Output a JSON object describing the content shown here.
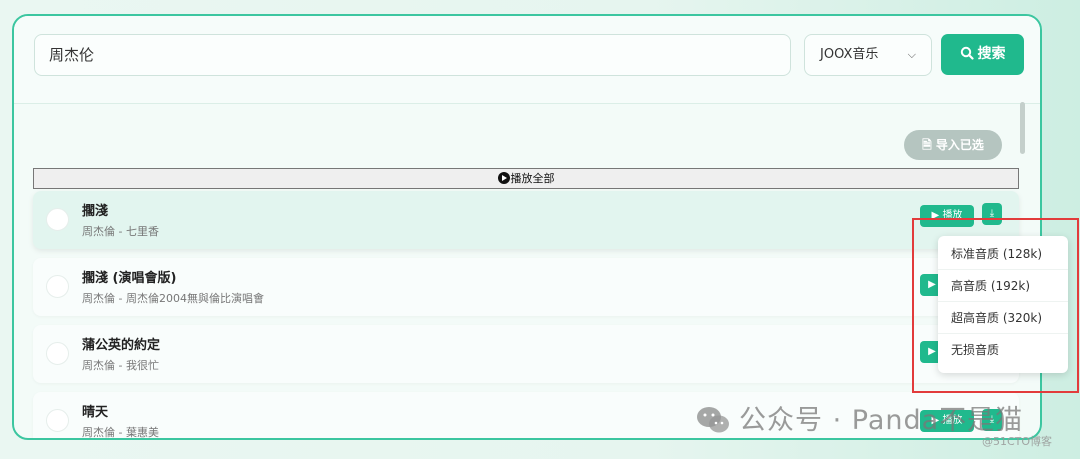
{
  "search": {
    "query": "周杰伦",
    "source": "JOOX音乐",
    "button_label": "搜索"
  },
  "toolbar": {
    "import_label": "导入已选",
    "play_all_label": "播放全部"
  },
  "songs": [
    {
      "title": "擱淺",
      "subtitle": "周杰倫 - 七里香",
      "play_label": "播放",
      "active": true
    },
    {
      "title": "擱淺 (演唱會版)",
      "subtitle": "周杰倫 - 周杰倫2004無與倫比演唱會",
      "play_label": "",
      "active": false
    },
    {
      "title": "蒲公英的約定",
      "subtitle": "周杰倫 - 我很忙",
      "play_label": "",
      "active": false
    },
    {
      "title": "晴天",
      "subtitle": "周杰倫 - 葉惠美",
      "play_label": "播放",
      "active": false
    }
  ],
  "quality_menu": {
    "items": [
      "标准音质 (128k)",
      "高音质 (192k)",
      "超高音质 (320k)",
      "无损音质"
    ]
  },
  "watermark": {
    "main": "公众号 · Panda不是猫",
    "secondary": "@51CTO博客"
  },
  "colors": {
    "accent": "#20b98d",
    "border": "#3cc6a0",
    "highlight": "#e23b3b"
  }
}
